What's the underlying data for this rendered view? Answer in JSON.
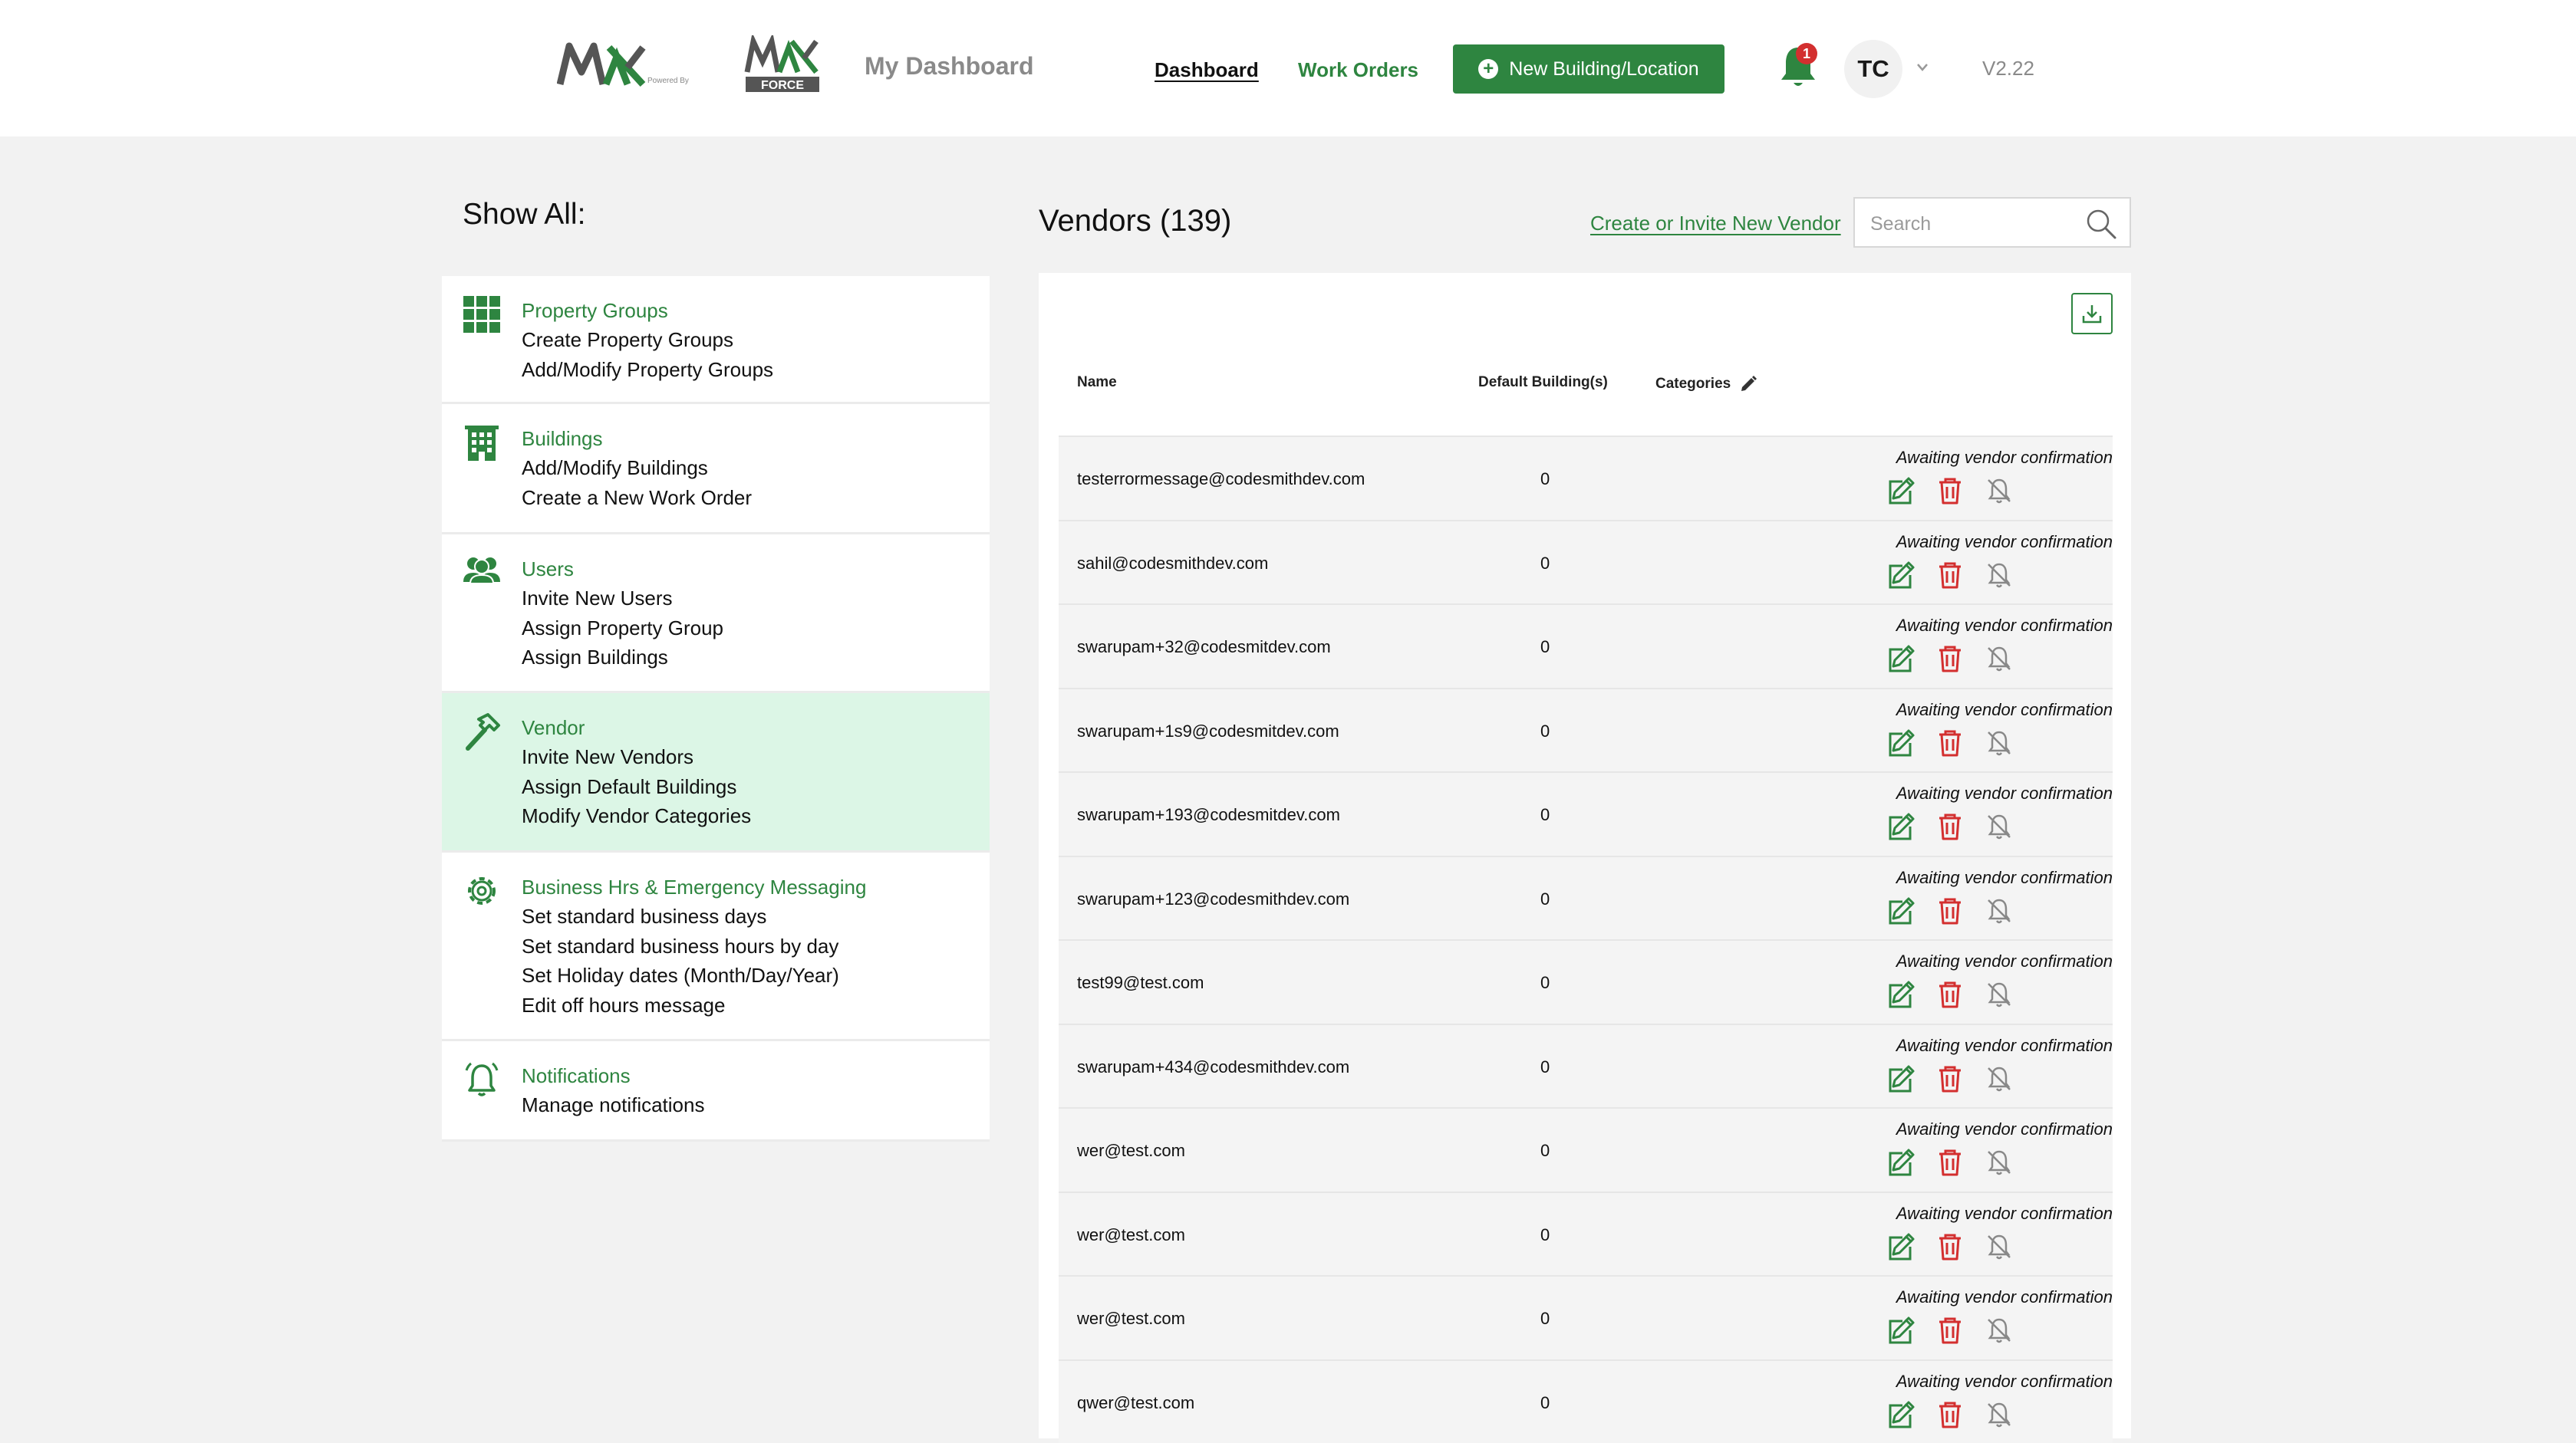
{
  "header": {
    "logo_mx": "MXA",
    "logo_powered": "Powered By",
    "logo_force_top": "MXA",
    "logo_force_bottom": "FORCE",
    "page_heading": "My Dashboard",
    "nav": {
      "dashboard": "Dashboard",
      "work_orders": "Work Orders"
    },
    "new_building_button": "New Building/Location",
    "notification_count": "1",
    "avatar_initials": "TC",
    "version": "V2.22"
  },
  "sidebar": {
    "heading": "Show All:",
    "sections": [
      {
        "title": "Property Groups",
        "links": [
          "Create Property Groups",
          "Add/Modify Property Groups"
        ]
      },
      {
        "title": "Buildings",
        "links": [
          "Add/Modify Buildings",
          "Create a New Work Order"
        ]
      },
      {
        "title": "Users",
        "links": [
          "Invite New Users",
          "Assign Property Group",
          "Assign Buildings"
        ]
      },
      {
        "title": "Vendor",
        "links": [
          "Invite New Vendors",
          "Assign Default Buildings",
          "Modify Vendor Categories"
        ]
      },
      {
        "title": "Business Hrs & Emergency Messaging",
        "links": [
          "Set standard business days",
          "Set standard business hours by day",
          "Set Holiday dates (Month/Day/Year)",
          "Edit off hours message"
        ]
      },
      {
        "title": "Notifications",
        "links": [
          "Manage notifications"
        ]
      }
    ]
  },
  "vendors": {
    "title": "Vendors (139)",
    "create_link": "Create or Invite New Vendor",
    "search_placeholder": "Search",
    "columns": {
      "name": "Name",
      "default_buildings": "Default Building(s)",
      "categories": "Categories"
    },
    "rows": [
      {
        "email": "testerrormessage@codesmithdev.com",
        "count": "0",
        "status": "Awaiting vendor confirmation"
      },
      {
        "email": "sahil@codesmithdev.com",
        "count": "0",
        "status": "Awaiting vendor confirmation"
      },
      {
        "email": "swarupam+32@codesmitdev.com",
        "count": "0",
        "status": "Awaiting vendor confirmation"
      },
      {
        "email": "swarupam+1s9@codesmitdev.com",
        "count": "0",
        "status": "Awaiting vendor confirmation"
      },
      {
        "email": "swarupam+193@codesmitdev.com",
        "count": "0",
        "status": "Awaiting vendor confirmation"
      },
      {
        "email": "swarupam+123@codesmithdev.com",
        "count": "0",
        "status": "Awaiting vendor confirmation"
      },
      {
        "email": "test99@test.com",
        "count": "0",
        "status": "Awaiting vendor confirmation"
      },
      {
        "email": "swarupam+434@codesmithdev.com",
        "count": "0",
        "status": "Awaiting vendor confirmation"
      },
      {
        "email": "wer@test.com",
        "count": "0",
        "status": "Awaiting vendor confirmation"
      },
      {
        "email": "wer@test.com",
        "count": "0",
        "status": "Awaiting vendor confirmation"
      },
      {
        "email": "wer@test.com",
        "count": "0",
        "status": "Awaiting vendor confirmation"
      },
      {
        "email": "qwer@test.com",
        "count": "0",
        "status": "Awaiting vendor confirmation"
      }
    ]
  },
  "colors": {
    "brand_green": "#2e8540",
    "delete_red": "#d32f2f",
    "active_bg": "#dcf6e6"
  }
}
